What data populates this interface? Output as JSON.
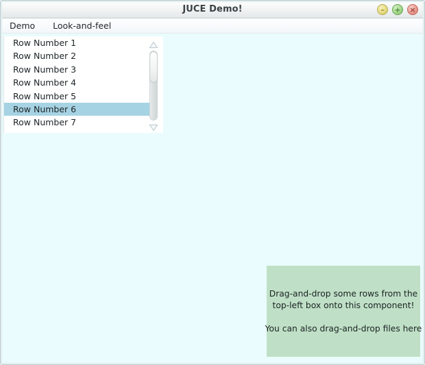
{
  "window": {
    "title": "JUCE Demo!",
    "buttons": [
      {
        "name": "minimize",
        "glyph": "–",
        "color": "#e7dc83"
      },
      {
        "name": "maximize",
        "glyph": "+",
        "color": "#a6d98d"
      },
      {
        "name": "close",
        "glyph": "×",
        "color": "#e89b90"
      }
    ],
    "background_color": "#eafcfd"
  },
  "menubar": {
    "items": [
      {
        "label": "Demo"
      },
      {
        "label": "Look-and-feel"
      }
    ]
  },
  "listbox": {
    "rows": [
      {
        "label": "Row Number 1",
        "selected": false
      },
      {
        "label": "Row Number 2",
        "selected": false
      },
      {
        "label": "Row Number 3",
        "selected": false
      },
      {
        "label": "Row Number 4",
        "selected": false
      },
      {
        "label": "Row Number 5",
        "selected": false
      },
      {
        "label": "Row Number 6",
        "selected": true
      },
      {
        "label": "Row Number 7",
        "selected": false
      }
    ],
    "selected_row": "Row Number 6",
    "selection_color": "#a6d3e3",
    "background_color": "#ffffff"
  },
  "scrollbar": {
    "up_arrow_icon": "triangle-up-icon",
    "down_arrow_icon": "triangle-down-icon"
  },
  "drop_target": {
    "line1": "Drag-and-drop some rows from the",
    "line2": "top-left box onto this component!",
    "line3": "You can also drag-and-drop files here",
    "background_color": "#bfe0c6"
  }
}
